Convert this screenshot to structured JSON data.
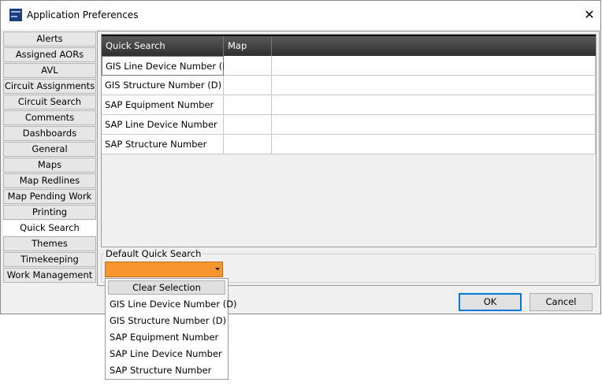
{
  "window": {
    "title": "Application Preferences",
    "close_glyph": "✕"
  },
  "tabs": [
    {
      "label": "Alerts"
    },
    {
      "label": "Assigned AORs"
    },
    {
      "label": "AVL"
    },
    {
      "label": "Circuit Assignments"
    },
    {
      "label": "Circuit Search"
    },
    {
      "label": "Comments"
    },
    {
      "label": "Dashboards"
    },
    {
      "label": "General"
    },
    {
      "label": "Maps"
    },
    {
      "label": "Map Redlines"
    },
    {
      "label": "Map Pending Work"
    },
    {
      "label": "Printing"
    },
    {
      "label": "Quick Search",
      "active": true
    },
    {
      "label": "Themes"
    },
    {
      "label": "Timekeeping"
    },
    {
      "label": "Work Management"
    }
  ],
  "grid": {
    "columns": [
      "Quick Search",
      "Map View"
    ],
    "rows": [
      [
        "GIS Line Device Number (D)",
        ""
      ],
      [
        "GIS Structure Number (D)",
        ""
      ],
      [
        "SAP Equipment Number",
        ""
      ],
      [
        "SAP Line Device Number",
        ""
      ],
      [
        "SAP Structure Number",
        ""
      ]
    ]
  },
  "default_quick_search": {
    "label": "Default Quick Search",
    "selected_value": "",
    "dropdown": {
      "clear_label": "Clear Selection",
      "options": [
        "GIS Line Device Number (D)",
        "GIS Structure Number (D)",
        "SAP Equipment Number",
        "SAP Line Device Number",
        "SAP Structure Number"
      ]
    }
  },
  "buttons": {
    "ok": "OK",
    "cancel": "Cancel"
  },
  "colors": {
    "combo_accent": "#f7962f",
    "header_dark": "#3a3a3a",
    "ok_border": "#0078d7"
  }
}
